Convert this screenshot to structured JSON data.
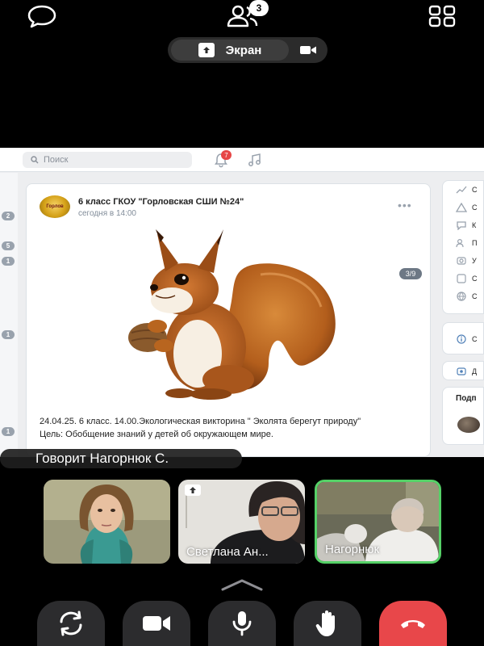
{
  "top_bar": {
    "participants_count": "3",
    "screen_share_label": "Экран"
  },
  "shared_screen": {
    "search_placeholder": "Поиск",
    "notifications_badge": "7",
    "left_rail_badges": [
      "2",
      "5",
      "1",
      "1",
      "1"
    ],
    "post": {
      "author": "6 класс ГКОУ \"Горловская СШИ №24\"",
      "time": "сегодня в 14:00",
      "more": "•••",
      "avatar_text": "Горлов",
      "image_counter": "3/9",
      "text_line1": "24.04.25. 6 класс. 14.00.Экологическая викторина \" Эколята берегут природу\"",
      "text_line2": "Цель: Обобщение знаний у детей об окружающем мире."
    },
    "right_panel": {
      "items": [
        "С",
        "С",
        "К",
        "П",
        "У",
        "С",
        "С"
      ],
      "info_item": "С",
      "d_item": "Д",
      "subs_label": "Подп"
    }
  },
  "speaking_indicator": "Говорит Нагорнюк С.",
  "participants": [
    {
      "name": ""
    },
    {
      "name": "Светлана Ан..."
    },
    {
      "name": "Нагорнюк"
    }
  ],
  "colors": {
    "end_call": "#e8474a",
    "active_speaker_border": "#55d167",
    "control_bg": "#2c2c2e"
  }
}
